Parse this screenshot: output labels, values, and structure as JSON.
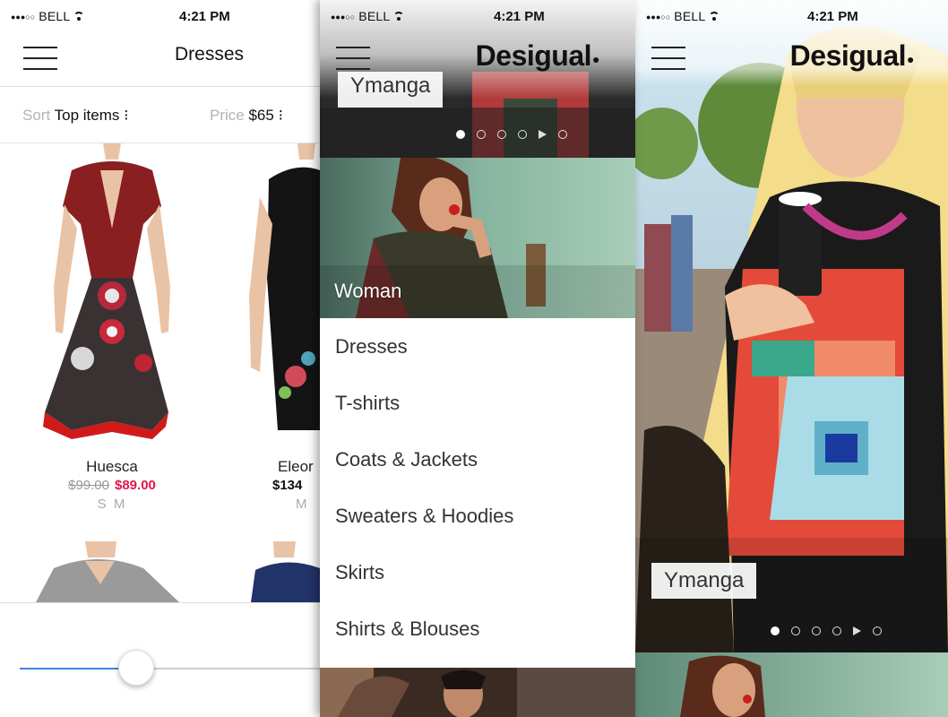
{
  "status": {
    "carrier": "BELL",
    "time": "4:21 PM"
  },
  "screen1": {
    "title": "Dresses",
    "sort_label": "Sort",
    "sort_value": "Top items",
    "price_label": "Price",
    "price_value": "$65",
    "products": [
      {
        "name": "Huesca",
        "old_price": "$99.00",
        "new_price": "$89.00",
        "sizes": "S  M"
      },
      {
        "name": "Eleor",
        "price": "$134",
        "sizes": "M"
      }
    ],
    "slider": {
      "value_fraction": 0.45
    }
  },
  "screen2": {
    "brand": "Desigual",
    "banner_tag": "Ymanga",
    "carousel": {
      "count": 6,
      "active_index": 0
    },
    "section_label": "Woman",
    "menu": [
      "Dresses",
      "T-shirts",
      "Coats & Jackets",
      "Sweaters & Hoodies",
      "Skirts",
      "Shirts & Blouses"
    ]
  },
  "screen3": {
    "brand": "Desigual",
    "banner_tag": "Ymanga",
    "carousel": {
      "count": 6,
      "active_index": 0
    }
  },
  "colors": {
    "accent": "#3a86d9",
    "sale": "#e0174a"
  },
  "icons": [
    "menu-icon",
    "wifi-icon",
    "sort-chevron-icon"
  ]
}
